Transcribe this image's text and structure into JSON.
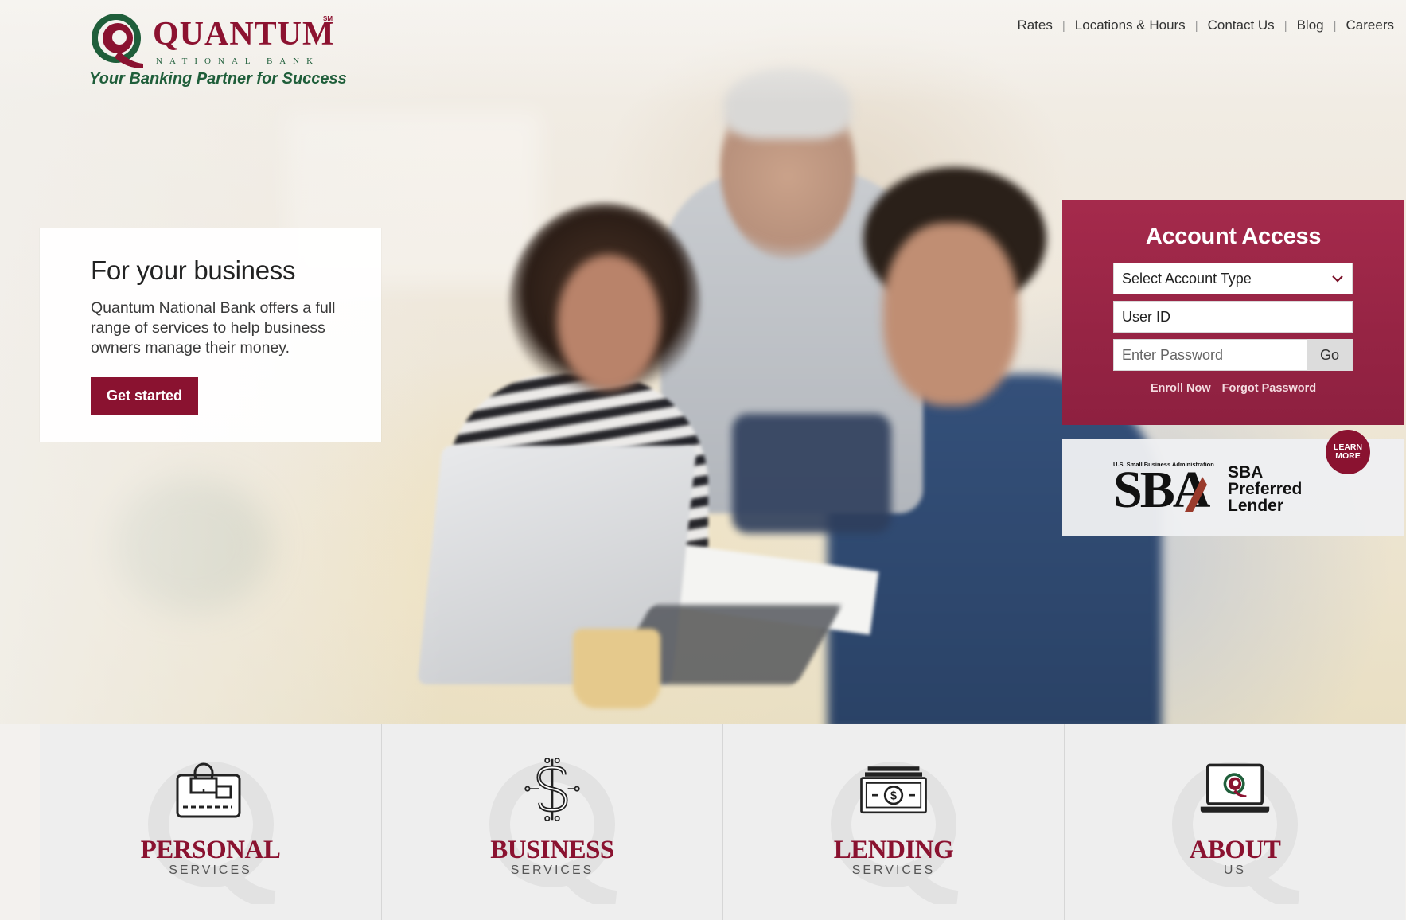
{
  "brand": {
    "name": "QUANTUM",
    "tm": "SM",
    "subtitle": "NATIONAL BANK",
    "tagline": "Your Banking Partner for Success",
    "colors": {
      "primary": "#8a1230",
      "green": "#1f5e3a"
    }
  },
  "topnav": {
    "items": [
      "Rates",
      "Locations & Hours",
      "Contact Us",
      "Blog",
      "Careers"
    ]
  },
  "hero": {
    "title": "For your business",
    "text": "Quantum National Bank offers a full range of services to help business owners manage their money.",
    "button": "Get started"
  },
  "access": {
    "title": "Account Access",
    "select_value": "Select Account Type",
    "userid_placeholder": "User ID",
    "password_placeholder": "Enter Password",
    "go_label": "Go",
    "enroll_label": "Enroll Now",
    "forgot_label": "Forgot Password"
  },
  "sba": {
    "small_text": "U.S. Small Business Administration",
    "big_text": "SBA",
    "line1": "SBA",
    "line2": "Preferred",
    "line3": "Lender",
    "learn_more": "LEARN MORE"
  },
  "tiles": [
    {
      "main": "PERSONAL",
      "sub": "SERVICES",
      "icon": "credit-card-lock-icon"
    },
    {
      "main": "BUSINESS",
      "sub": "SERVICES",
      "icon": "dollar-circuit-icon"
    },
    {
      "main": "LENDING",
      "sub": "SERVICES",
      "icon": "cash-stack-icon"
    },
    {
      "main": "ABOUT",
      "sub": "US",
      "icon": "laptop-logo-icon"
    }
  ]
}
